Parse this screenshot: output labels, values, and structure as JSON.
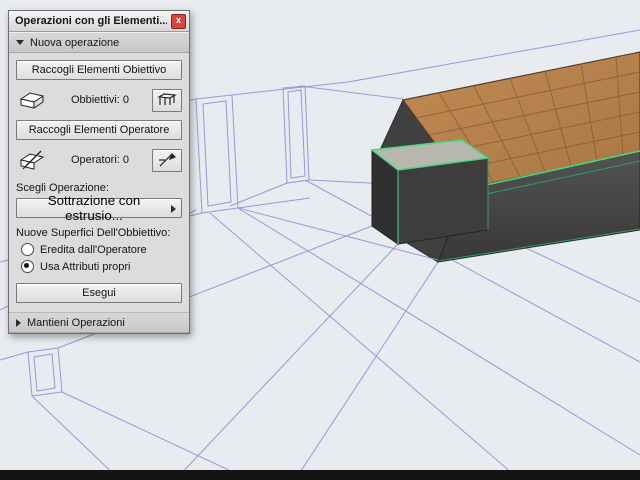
{
  "window": {
    "title": "Operazioni con gli Elementi...",
    "close": "x"
  },
  "sections": {
    "new_operation": "Nuova operazione",
    "keep_operations": "Mantieni Operazioni"
  },
  "buttons": {
    "collect_targets": "Raccogli Elementi Obiettivo",
    "collect_operators": "Raccogli Elementi Operatore",
    "execute": "Esegui"
  },
  "counters": {
    "targets_label": "Obbiettivi:",
    "targets_value": "0",
    "operators_label": "Operatori:",
    "operators_value": "0"
  },
  "operation": {
    "label": "Scegli Operazione:",
    "selected": "Sottrazione con estrusio..."
  },
  "surfaces": {
    "label": "Nuove Superfici Dell'Obbiettivo:",
    "options": [
      {
        "label": "Eredita dall'Operatore",
        "selected": false
      },
      {
        "label": "Usa Attributi propri",
        "selected": true
      }
    ]
  },
  "colors": {
    "viewport_background": "#e8ebef",
    "wireframe": "#8f94dd",
    "tile_surface": "#b5824e",
    "tile_grout": "#7a5833",
    "solid_dark_face": "#454545",
    "edge_highlight_green": "#46d684",
    "edge_highlight_teal": "#2f9e66",
    "palette_background": "#dcdcdc",
    "close_button_red": "#d8453c"
  }
}
